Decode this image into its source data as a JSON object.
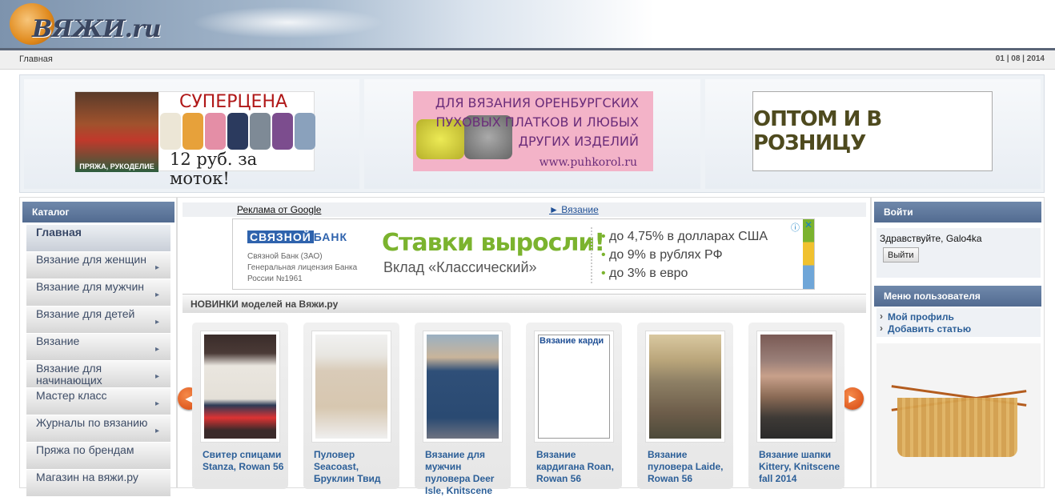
{
  "site": {
    "logo": "ВЯЖИ",
    "logo_suffix": ".ru"
  },
  "breadcrumb": "Главная",
  "date": "01 | 08 | 2014",
  "banners": {
    "b1_headline": "СУПЕРЦЕНА",
    "b1_price": "12 руб. за моток!",
    "b1_brand": "ПРЯЖА, РУКОДЕЛИЕ",
    "b2_text": "ДЛЯ ВЯЗАНИЯ ОРЕНБУРГСКИХ ПУХОВЫХ ПЛАТКОВ И ЛЮБЫХ ДРУГИХ ИЗДЕЛИЙ",
    "b2_url": "www.puhkorol.ru",
    "b3_text": "ОПТОМ И В РОЗНИЦУ"
  },
  "catalog": {
    "title": "Каталог",
    "items": [
      {
        "label": "Главная",
        "arrow": ""
      },
      {
        "label": "Вязание для женщин",
        "arrow": "▸"
      },
      {
        "label": "Вязание для мужчин",
        "arrow": "▸"
      },
      {
        "label": "Вязание для детей",
        "arrow": "▸"
      },
      {
        "label": "Вязание",
        "arrow": "▸"
      },
      {
        "label": "Вязание для начинающих",
        "arrow": "▸"
      },
      {
        "label": "Мастер класс",
        "arrow": "▸"
      },
      {
        "label": "Журналы по вязанию",
        "arrow": "▸"
      },
      {
        "label": "Пряжа по брендам",
        "arrow": ""
      },
      {
        "label": "Магазин на вяжи.ру",
        "arrow": ""
      }
    ]
  },
  "ads": {
    "label": "Реклама от Google",
    "link": "► Вязание",
    "bank_logo": "СВЯЗНОЙ",
    "bank_logo2": "БАНК",
    "bank_small": "Связной Банк (ЗАО) Генеральная лицензия Банка России №1961",
    "headline": "Ставки выросли!",
    "subline": "Вклад «Классический»",
    "bullets": [
      "до 4,75% в долларах США",
      "до 9% в рублях РФ",
      "до 3% в евро"
    ]
  },
  "new_models": {
    "title": "НОВИНКИ моделей на Вяжи.ру",
    "prev": "◀",
    "next": "▶",
    "items": [
      {
        "caption": "Свитер спицами Stanza, Rowan 56",
        "alt": ""
      },
      {
        "caption": "Пуловер Seacoast, Бруклин Твид",
        "alt": ""
      },
      {
        "caption": "Вязание для мужчин пуловера Deer Isle, Knitscene",
        "alt": ""
      },
      {
        "caption": "Вязание кардигана Roan, Rowan 56",
        "alt": "Вязание карди"
      },
      {
        "caption": "Вязание пуловера Laide, Rowan 56",
        "alt": ""
      },
      {
        "caption": "Вязание шапки Kittery, Knitscene fall 2014",
        "alt": ""
      }
    ]
  },
  "login": {
    "title": "Войти",
    "greeting": "Здравствуйте, Galo4ka",
    "logout": "Выйти"
  },
  "user_menu": {
    "title": "Меню пользователя",
    "items": [
      "Мой профиль",
      "Добавить статью"
    ]
  },
  "colors": {
    "accent": "#526b91",
    "link": "#2c5f98",
    "nav_button": "#d6460e"
  }
}
